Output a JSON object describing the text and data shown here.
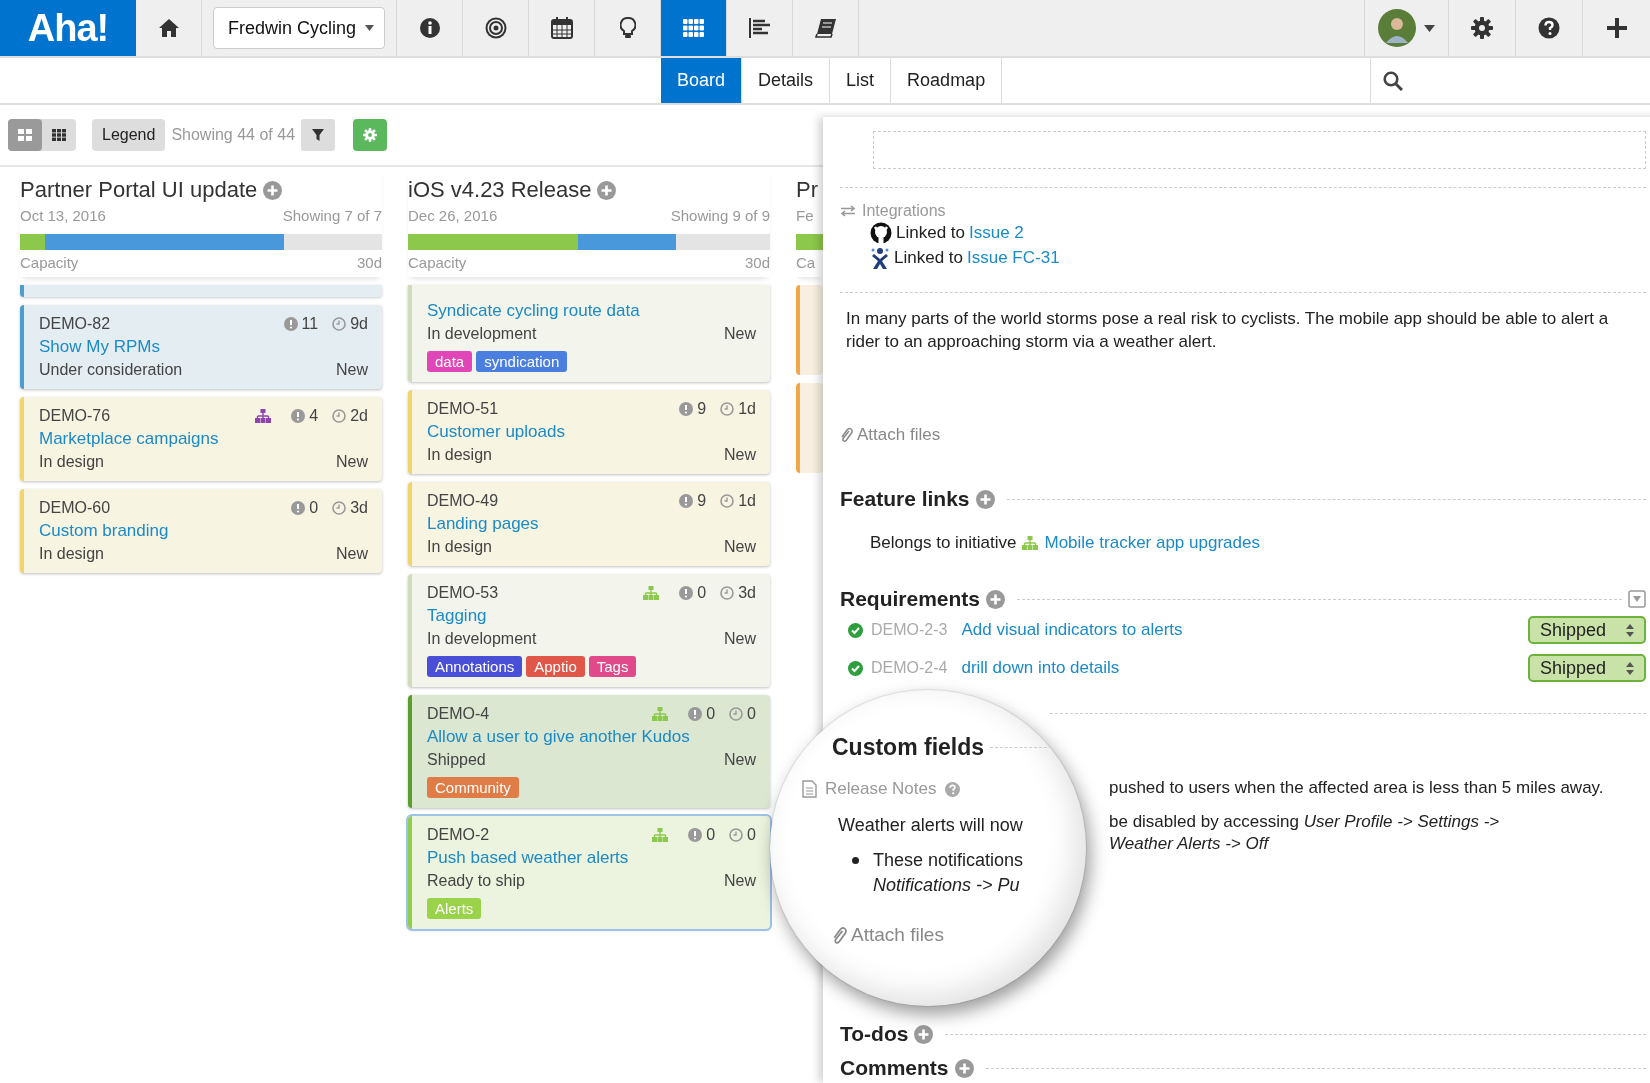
{
  "logo": "Aha!",
  "nav": [
    {
      "kind": "home",
      "selected": false
    },
    {
      "kind": "workspace",
      "label": "Fredwin Cycling"
    },
    {
      "kind": "info",
      "selected": false
    },
    {
      "kind": "target",
      "selected": false
    },
    {
      "kind": "calendar",
      "selected": false
    },
    {
      "kind": "bulb",
      "selected": false
    },
    {
      "kind": "grid",
      "selected": true
    },
    {
      "kind": "lines",
      "selected": false
    },
    {
      "kind": "book",
      "selected": false
    }
  ],
  "tabs": [
    {
      "label": "Board",
      "selected": true
    },
    {
      "label": "Details",
      "selected": false
    },
    {
      "label": "List",
      "selected": false
    },
    {
      "label": "Roadmap",
      "selected": false
    }
  ],
  "toolbar": {
    "view_toggle": [
      {
        "kind": "cards",
        "selected": true
      },
      {
        "kind": "dense",
        "selected": false
      }
    ],
    "legend": "Legend",
    "showing": "Showing 44 of 44"
  },
  "columns": [
    {
      "title": "Partner Portal UI update",
      "date": "Oct 13, 2016",
      "showing": "Showing 7 of 7",
      "capacity_label": "Capacity",
      "capacity": "30d",
      "capacity_bar": {
        "level": 0.73,
        "done": {
          "level": 0.07
        }
      },
      "partial_top": {
        "kind": "consideration"
      },
      "cards": [
        {
          "kind": "consideration",
          "id": "DEMO-82",
          "title": "Show My RPMs",
          "status": "Under consideration",
          "workflow": "New",
          "score": "11",
          "estimate": "9d",
          "selected": false
        },
        {
          "kind": "design",
          "id": "DEMO-76",
          "title": "Marketplace campaigns",
          "status": "In design",
          "workflow": "New",
          "initiative": {
            "color": "#8e44ad"
          },
          "score": "4",
          "estimate": "2d",
          "selected": false
        },
        {
          "kind": "design",
          "id": "DEMO-60",
          "title": "Custom branding",
          "status": "In design",
          "workflow": "New",
          "score": "0",
          "estimate": "3d",
          "selected": false
        }
      ]
    },
    {
      "title": "iOS v4.23 Release",
      "date": "Dec 26, 2016",
      "showing": "Showing 9 of 9",
      "capacity_label": "Capacity",
      "capacity": "30d",
      "capacity_bar": {
        "level": 0.74,
        "done": {
          "level": 0.47
        }
      },
      "cards": [
        {
          "kind": "development",
          "title": "Syndicate cycling route data",
          "status": "In development",
          "workflow": "New",
          "tags": [
            {
              "label": "data",
              "color": "#e046b8"
            },
            {
              "label": "syndication",
              "color": "#4a7fe0"
            }
          ],
          "selected": false
        },
        {
          "kind": "design",
          "id": "DEMO-51",
          "title": "Customer uploads",
          "status": "In design",
          "workflow": "New",
          "score": "9",
          "estimate": "1d",
          "selected": false
        },
        {
          "kind": "design",
          "id": "DEMO-49",
          "title": "Landing pages",
          "status": "In design",
          "workflow": "New",
          "score": "9",
          "estimate": "1d",
          "selected": false
        },
        {
          "kind": "development",
          "id": "DEMO-53",
          "title": "Tagging",
          "status": "In development",
          "workflow": "New",
          "initiative": {
            "color": "#8cc84b"
          },
          "score": "0",
          "estimate": "3d",
          "tags": [
            {
              "label": "Annotations",
              "color": "#4a4fd8"
            },
            {
              "label": "Apptio",
              "color": "#e0574a"
            },
            {
              "label": "Tags",
              "color": "#e04a8a"
            }
          ],
          "selected": false
        },
        {
          "kind": "shipped",
          "id": "DEMO-4",
          "title": "Allow a user to give another Kudos",
          "status": "Shipped",
          "workflow": "New",
          "initiative": {
            "color": "#8cc84b"
          },
          "score": "0",
          "estimate": "0",
          "tags": [
            {
              "label": "Community",
              "color": "#e07c46"
            }
          ],
          "selected": false
        },
        {
          "kind": "ready",
          "id": "DEMO-2",
          "title": "Push based weather alerts",
          "status": "Ready to ship",
          "workflow": "New",
          "initiative": {
            "color": "#8cc84b"
          },
          "score": "0",
          "estimate": "0",
          "tags": [
            {
              "label": "Alerts",
              "color": "#9ad24a"
            }
          ],
          "selected": true
        }
      ]
    },
    {
      "title": "Pr",
      "date": "Fe",
      "capacity_label": "Ca"
    }
  ],
  "detail": {
    "integrations": {
      "label": "Integrations",
      "links": [
        {
          "kind": "github",
          "prefix": "Linked to",
          "link": "Issue 2"
        },
        {
          "kind": "jira",
          "prefix": "Linked to",
          "link": "Issue FC-31"
        }
      ]
    },
    "description": "In many parts of the world storms pose a real risk to cyclists. The mobile app should be able to alert a rider to an approaching storm via a weather alert.",
    "attach": "Attach files",
    "feature_links": {
      "heading": "Feature links",
      "prefix": "Belongs to initiative",
      "link": "Mobile tracker app upgrades"
    },
    "requirements": {
      "heading": "Requirements",
      "rows": [
        {
          "id": "DEMO-2-3",
          "title": "Add visual indicators to alerts",
          "status": "Shipped",
          "done": true
        },
        {
          "id": "DEMO-2-4",
          "title": "drill down into details",
          "status": "Shipped",
          "done": true
        }
      ]
    },
    "custom_fields": {
      "heading": "Custom fields",
      "field_label": "Release Notes",
      "lens_line": "Weather alerts will now",
      "lens_bullet": "These notifications",
      "lens_bullet_2": "Notifications -> Pu",
      "lens_attach": "Attach files",
      "line": "pushed to users when the affected area is less than 5 miles away.",
      "bullet": "be disabled by accessing *User Profile -> Settings ->*",
      "bullet_2": "Weather Alerts -> Off"
    },
    "todos": "To-dos",
    "comments": "Comments"
  }
}
